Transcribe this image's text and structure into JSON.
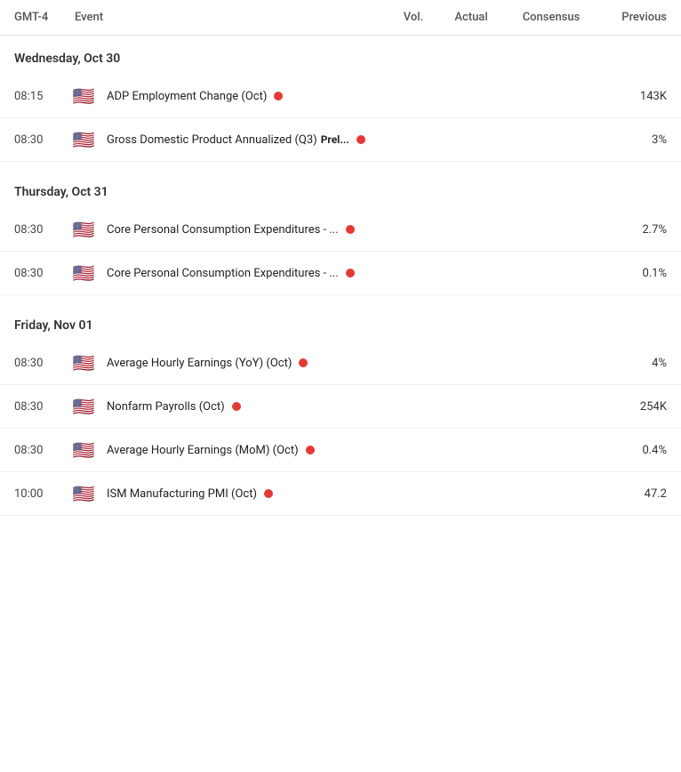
{
  "header": {
    "timezone": "GMT-4",
    "col_event": "Event",
    "col_vol": "Vol.",
    "col_actual": "Actual",
    "col_consensus": "Consensus",
    "col_previous": "Previous"
  },
  "days": [
    {
      "label": "Wednesday, Oct 30",
      "events": [
        {
          "time": "08:15",
          "flag": "🇺🇸",
          "name": "ADP Employment Change (Oct)",
          "badge": "",
          "has_vol": true,
          "actual": "",
          "consensus": "",
          "previous": "143K"
        },
        {
          "time": "08:30",
          "flag": "🇺🇸",
          "name": "Gross Domestic Product Annualized (Q3)",
          "badge": "Prel...",
          "has_vol": true,
          "actual": "",
          "consensus": "",
          "previous": "3%"
        }
      ]
    },
    {
      "label": "Thursday, Oct 31",
      "events": [
        {
          "time": "08:30",
          "flag": "🇺🇸",
          "name": "Core Personal Consumption Expenditures - ...",
          "badge": "",
          "has_vol": true,
          "actual": "",
          "consensus": "",
          "previous": "2.7%"
        },
        {
          "time": "08:30",
          "flag": "🇺🇸",
          "name": "Core Personal Consumption Expenditures - ...",
          "badge": "",
          "has_vol": true,
          "actual": "",
          "consensus": "",
          "previous": "0.1%"
        }
      ]
    },
    {
      "label": "Friday, Nov 01",
      "events": [
        {
          "time": "08:30",
          "flag": "🇺🇸",
          "name": "Average Hourly Earnings (YoY) (Oct)",
          "badge": "",
          "has_vol": true,
          "actual": "",
          "consensus": "",
          "previous": "4%"
        },
        {
          "time": "08:30",
          "flag": "🇺🇸",
          "name": "Nonfarm Payrolls (Oct)",
          "badge": "",
          "has_vol": true,
          "actual": "",
          "consensus": "",
          "previous": "254K"
        },
        {
          "time": "08:30",
          "flag": "🇺🇸",
          "name": "Average Hourly Earnings (MoM) (Oct)",
          "badge": "",
          "has_vol": true,
          "actual": "",
          "consensus": "",
          "previous": "0.4%"
        },
        {
          "time": "10:00",
          "flag": "🇺🇸",
          "name": "ISM Manufacturing PMI (Oct)",
          "badge": "",
          "has_vol": true,
          "actual": "",
          "consensus": "",
          "previous": "47.2"
        }
      ]
    }
  ]
}
